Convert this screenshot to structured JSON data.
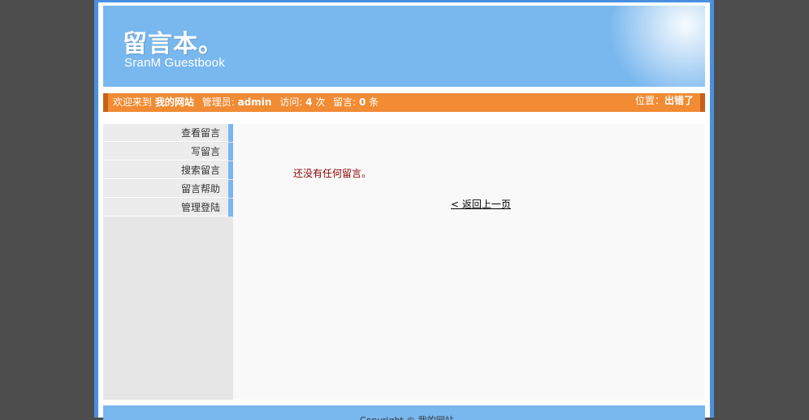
{
  "banner": {
    "logo_cn": "留言本。",
    "logo_en": "SranM Guestbook"
  },
  "status_bar": {
    "welcome_prefix": "欢迎来到",
    "site_name": "我的网站",
    "admin_label": "管理员:",
    "admin_name": "admin",
    "visits_label": "访问:",
    "visits_count": "4",
    "visits_unit": "次",
    "messages_label": "留言:",
    "messages_count": "0",
    "messages_unit": "条",
    "location_label": "位置：",
    "location_value": "出错了"
  },
  "sidebar": {
    "items": [
      {
        "label": "查看留言"
      },
      {
        "label": "写留言"
      },
      {
        "label": "搜索留言"
      },
      {
        "label": "留言帮助"
      },
      {
        "label": "管理登陆"
      }
    ]
  },
  "main": {
    "empty_message": "还没有任何留言。",
    "back_link": "< 返回上一页"
  },
  "footer": {
    "copyright": "Copyright © 我的网站"
  },
  "colors": {
    "banner_bg": "#79b7ef",
    "status_bar_bg": "#f18b34",
    "frame_border": "#4a90e2",
    "page_bg": "#4d4d4d",
    "empty_message": "#8a0000"
  }
}
